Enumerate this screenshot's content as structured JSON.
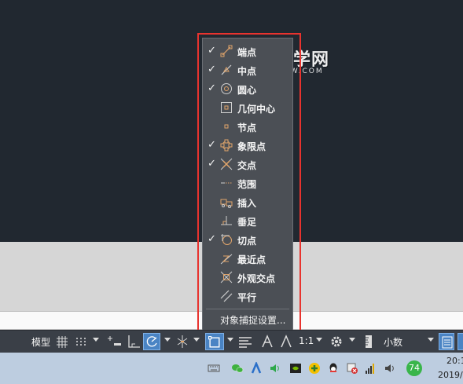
{
  "watermark": {
    "text": "软件自学网",
    "url_text": "WWW.RJZXW.COM"
  },
  "snap_menu": {
    "items": [
      {
        "label": "端点",
        "checked": true,
        "icon": "endpoint-icon"
      },
      {
        "label": "中点",
        "checked": true,
        "icon": "midpoint-icon"
      },
      {
        "label": "圆心",
        "checked": true,
        "icon": "center-icon"
      },
      {
        "label": "几何中心",
        "checked": false,
        "icon": "geometric-center-icon"
      },
      {
        "label": "节点",
        "checked": false,
        "icon": "node-icon"
      },
      {
        "label": "象限点",
        "checked": true,
        "icon": "quadrant-icon"
      },
      {
        "label": "交点",
        "checked": true,
        "icon": "intersection-icon"
      },
      {
        "label": "范围",
        "checked": false,
        "icon": "extension-icon"
      },
      {
        "label": "插入",
        "checked": false,
        "icon": "insertion-icon"
      },
      {
        "label": "垂足",
        "checked": false,
        "icon": "perpendicular-icon"
      },
      {
        "label": "切点",
        "checked": true,
        "icon": "tangent-icon"
      },
      {
        "label": "最近点",
        "checked": false,
        "icon": "nearest-icon"
      },
      {
        "label": "外观交点",
        "checked": false,
        "icon": "apparent-intersection-icon"
      },
      {
        "label": "平行",
        "checked": false,
        "icon": "parallel-icon"
      }
    ],
    "check_mark": "✓",
    "settings_label": "对象捕捉设置..."
  },
  "status_bar": {
    "model_label": "模型",
    "scale_label": "1:1",
    "units_label": "小数"
  },
  "taskbar": {
    "badge_count": "74",
    "clock_time": "20:1",
    "clock_date": "2019/"
  },
  "colors": {
    "accent": "#4a84c4",
    "highlight_border": "#e8332e",
    "icon_orange": "#e0a46a"
  }
}
